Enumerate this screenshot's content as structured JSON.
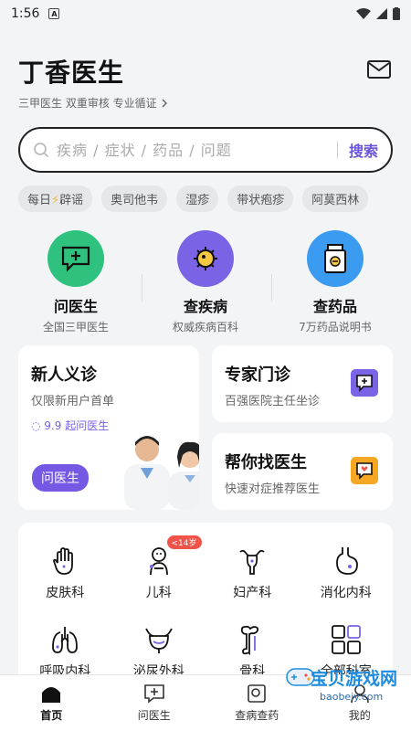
{
  "status_bar": {
    "time": "1:56"
  },
  "header": {
    "title": "丁香医生",
    "subtitle": "三甲医生 双重审核 专业循证"
  },
  "search": {
    "placeholder": "疾病 / 症状 / 药品 / 问题",
    "button": "搜索"
  },
  "chips": [
    {
      "label_a": "每日",
      "bolt": "⚡",
      "label_b": "辟谣"
    },
    {
      "label": "奥司他韦"
    },
    {
      "label": "湿疹"
    },
    {
      "label": "带状疱疹"
    },
    {
      "label": "阿莫西林"
    }
  ],
  "quick_actions": [
    {
      "title": "问医生",
      "subtitle": "全国三甲医生",
      "color": "#2ec27e"
    },
    {
      "title": "查疾病",
      "subtitle": "权威疾病百科",
      "color": "#7b63e6"
    },
    {
      "title": "查药品",
      "subtitle": "7万药品说明书",
      "color": "#3a9bf0"
    }
  ],
  "promo": {
    "title": "新人义诊",
    "subtitle": "仅限新用户首单",
    "price": "9.9 起问医生",
    "button": "问医生"
  },
  "expert": {
    "title": "专家门诊",
    "subtitle": "百强医院主任坐诊",
    "icon_color": "#7b63e6"
  },
  "find_doctor": {
    "title": "帮你找医生",
    "subtitle": "快速对症推荐医生",
    "icon_color": "#f5a623"
  },
  "departments": [
    {
      "label": "皮肤科",
      "icon": "hand-icon"
    },
    {
      "label": "儿科",
      "icon": "baby-icon",
      "badge": "<14岁"
    },
    {
      "label": "妇产科",
      "icon": "uterus-icon"
    },
    {
      "label": "消化内科",
      "icon": "stomach-icon"
    },
    {
      "label": "呼吸内科",
      "icon": "lungs-icon"
    },
    {
      "label": "泌尿外科",
      "icon": "bladder-icon"
    },
    {
      "label": "骨科",
      "icon": "bone-icon"
    },
    {
      "label": "全部科室",
      "icon": "grid-icon"
    }
  ],
  "tabs": [
    {
      "label": "首页",
      "active": true
    },
    {
      "label": "问医生"
    },
    {
      "label": "查病查药"
    },
    {
      "label": "我的"
    }
  ],
  "watermark": {
    "text": "宝贝游戏网",
    "url": "baobeiy.com"
  },
  "colors": {
    "accent": "#6b56d9",
    "background": "#f3f4f6"
  }
}
